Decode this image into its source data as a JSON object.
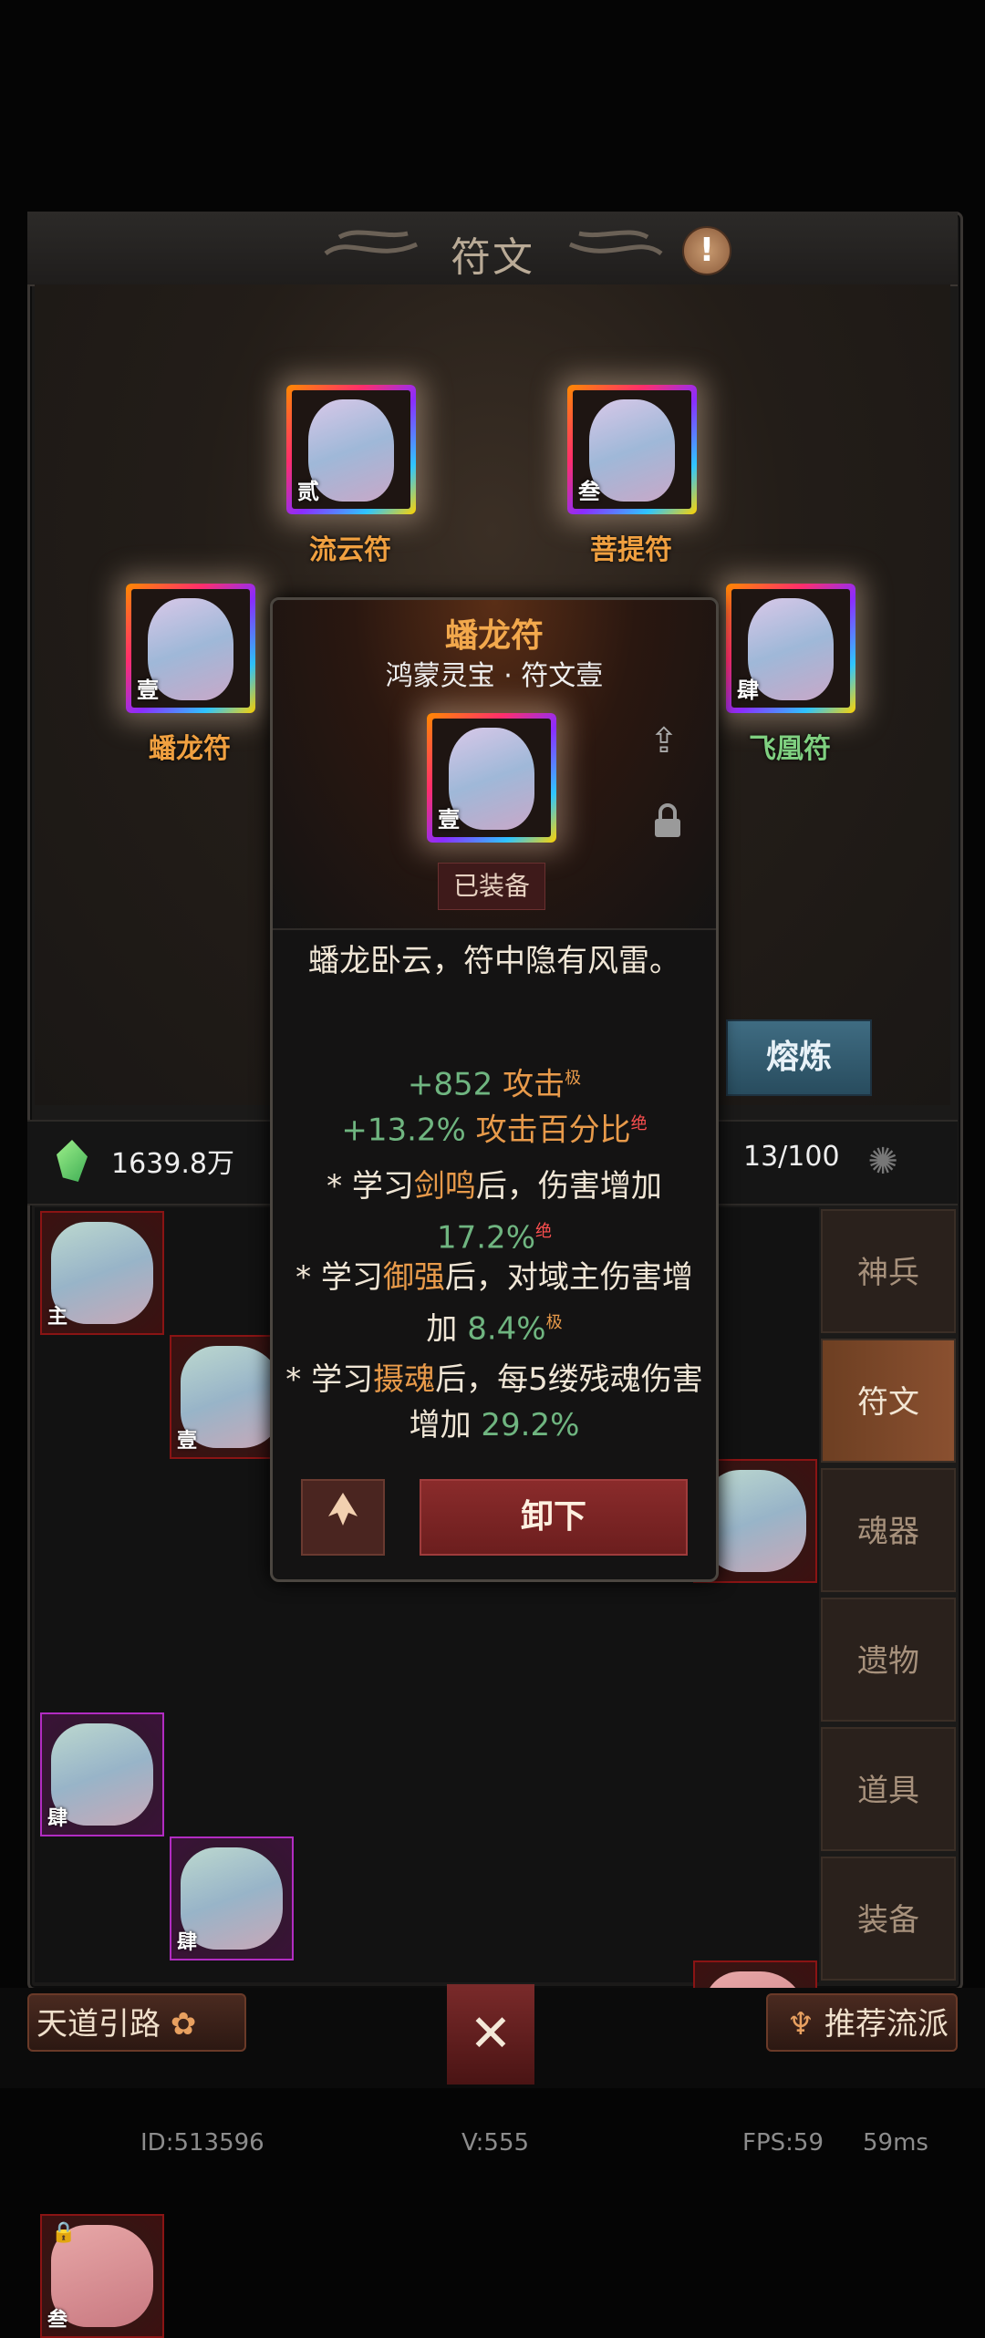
{
  "panel": {
    "title": "符文",
    "info_icon": "!"
  },
  "rune_slots": [
    {
      "name": "流云符",
      "num": "贰",
      "color": "#f0a040"
    },
    {
      "name": "菩提符",
      "num": "叁",
      "color": "#f0a040"
    },
    {
      "name": "蟠龙符",
      "num": "壹",
      "color": "#f0a040"
    },
    {
      "name": "飞凰符",
      "num": "肆",
      "color": "#7fd080"
    }
  ],
  "smelt_label": "熔炼",
  "currency": {
    "amount": "1639.8万",
    "capacity": "13/100"
  },
  "inventory": [
    {
      "num": "主"
    },
    {
      "num": "壹"
    },
    {
      "num": "肆"
    },
    {
      "num": "肆"
    },
    {
      "num": "叁"
    }
  ],
  "tabs": [
    "神兵",
    "符文",
    "魂器",
    "遗物",
    "道具",
    "装备"
  ],
  "popup": {
    "title": "蟠龙符",
    "subtitle": "鸿蒙灵宝 · 符文壹",
    "slot_num": "壹",
    "equipped": "已装备",
    "description": "蟠龙卧云，符中隐有风雷。",
    "stat1_value": "+852",
    "stat1_name": "攻击",
    "stat1_grade": "极",
    "stat2_value": "+13.2%",
    "stat2_name": "攻击百分比",
    "stat2_grade": "绝",
    "effect1_pre": "* 学习",
    "effect1_skill": "剑鸣",
    "effect1_post": "后，伤害增加",
    "effect1_value": "17.2%",
    "effect1_grade": "绝",
    "effect2_pre": "* 学习",
    "effect2_skill": "御强",
    "effect2_post": "后，对域主伤害增加",
    "effect2_value": "8.4%",
    "effect2_grade": "极",
    "effect3_pre": "* 学习",
    "effect3_skill": "摄魂",
    "effect3_post": "后，每5缕残魂伤害增加",
    "effect3_value": "29.2%",
    "unequip_label": "卸下"
  },
  "bottom": {
    "left_label": "天道引路",
    "right_label": "推荐流派"
  },
  "debug": {
    "id": "ID:513596",
    "version": "V:555",
    "fps": "FPS:59",
    "ms": "59ms"
  }
}
